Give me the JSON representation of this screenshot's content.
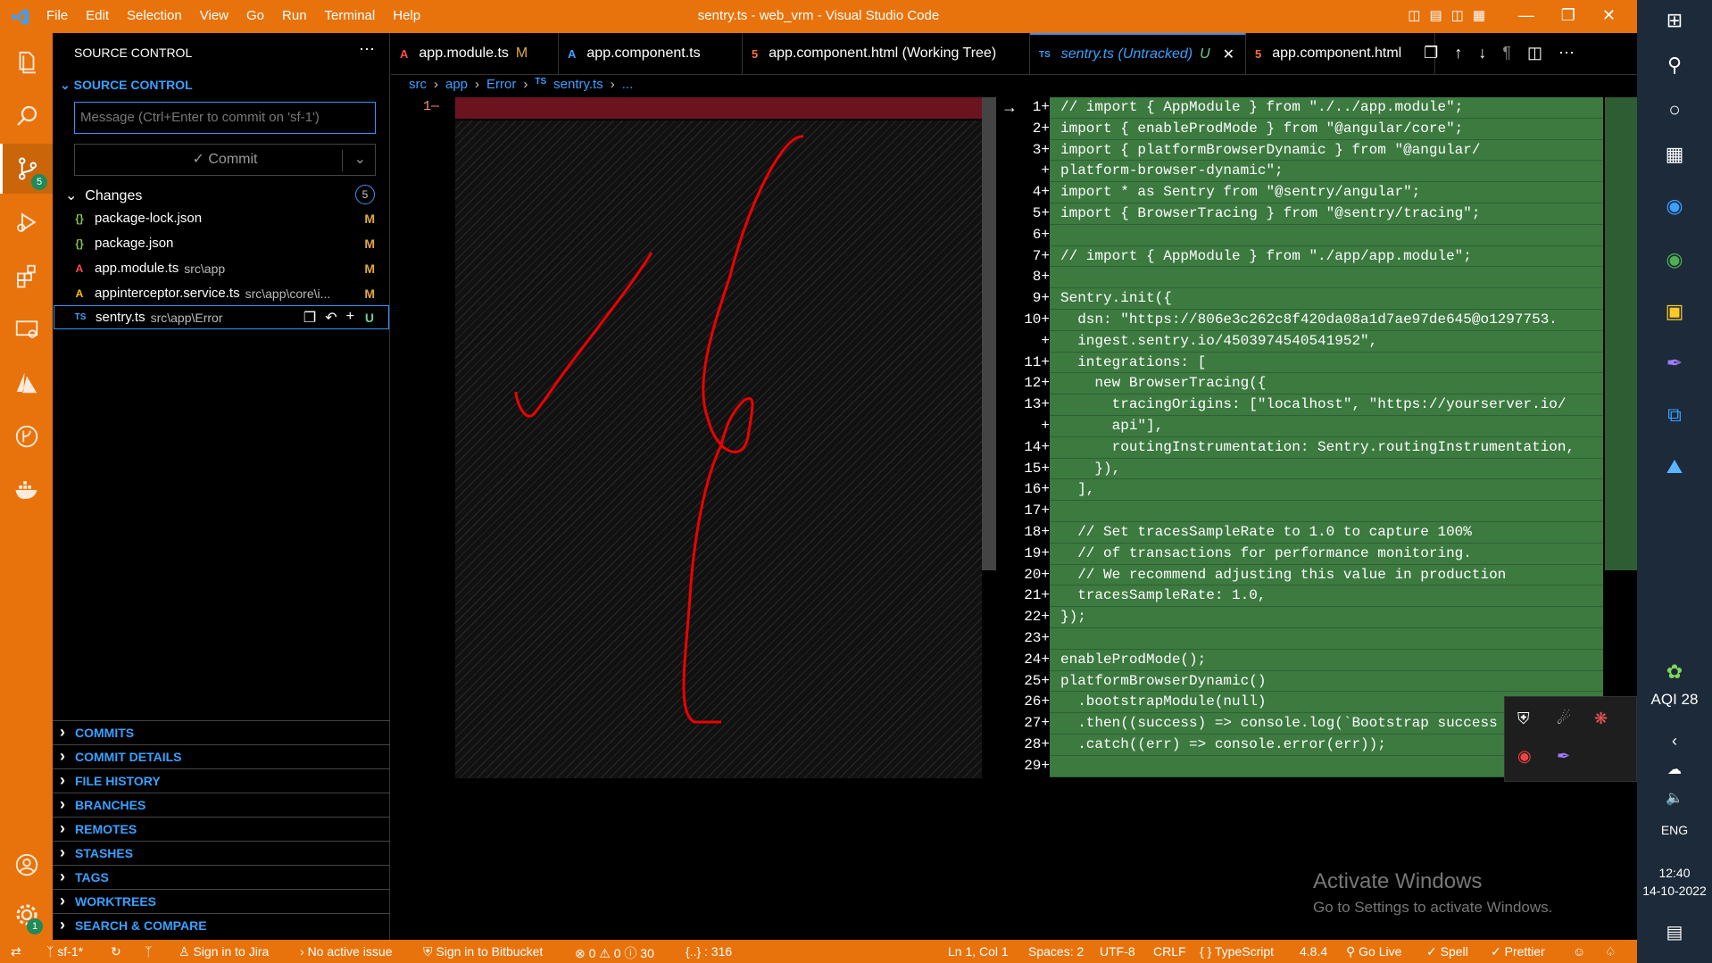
{
  "window": {
    "title": "sentry.ts - web_vrm - Visual Studio Code",
    "menu": [
      "File",
      "Edit",
      "Selection",
      "View",
      "Go",
      "Run",
      "Terminal",
      "Help"
    ]
  },
  "sidebar": {
    "title": "SOURCE CONTROL",
    "section": "SOURCE CONTROL",
    "message_placeholder": "Message (Ctrl+Enter to commit on 'sf-1')",
    "commit_label": "✓ Commit",
    "changes_label": "Changes",
    "changes_count": "5",
    "files": [
      {
        "name": "package-lock.json",
        "path": "",
        "status": "M",
        "icon": "{}"
      },
      {
        "name": "package.json",
        "path": "",
        "status": "M",
        "icon": "{}"
      },
      {
        "name": "app.module.ts",
        "path": "src\\app",
        "status": "M",
        "icon": "A"
      },
      {
        "name": "appinterceptor.service.ts",
        "path": "src\\app\\core\\i...",
        "status": "M",
        "icon": "A"
      },
      {
        "name": "sentry.ts",
        "path": "src\\app\\Error",
        "status": "U",
        "icon": "TS"
      }
    ],
    "panels": [
      "COMMITS",
      "COMMIT DETAILS",
      "FILE HISTORY",
      "BRANCHES",
      "REMOTES",
      "STASHES",
      "TAGS",
      "WORKTREES",
      "SEARCH & COMPARE"
    ]
  },
  "activity_badges": {
    "scm": "5",
    "settings": "1"
  },
  "tabs": [
    {
      "label": "app.module.ts",
      "mod": "M"
    },
    {
      "label": "app.component.ts",
      "mod": ""
    },
    {
      "label": "app.component.html (Working Tree)",
      "mod": ""
    },
    {
      "label": "sentry.ts (Untracked)",
      "mod": "U"
    },
    {
      "label": "app.component.html",
      "mod": ""
    }
  ],
  "breadcrumb": [
    "src",
    "app",
    "Error",
    "sentry.ts",
    "..."
  ],
  "left_line": "1",
  "code_lines": [
    {
      "n": "1+",
      "t": "// import { AppModule } from \"./../app.module\";"
    },
    {
      "n": "2+",
      "t": "import { enableProdMode } from \"@angular/core\";"
    },
    {
      "n": "3+",
      "t": "import { platformBrowserDynamic } from \"@angular/"
    },
    {
      "n": "+",
      "t": "platform-browser-dynamic\";"
    },
    {
      "n": "4+",
      "t": "import * as Sentry from \"@sentry/angular\";"
    },
    {
      "n": "5+",
      "t": "import { BrowserTracing } from \"@sentry/tracing\";"
    },
    {
      "n": "6+",
      "t": ""
    },
    {
      "n": "7+",
      "t": "// import { AppModule } from \"./app/app.module\";"
    },
    {
      "n": "8+",
      "t": ""
    },
    {
      "n": "9+",
      "t": "Sentry.init({"
    },
    {
      "n": "10+",
      "t": "  dsn: \"https://806e3c262c8f420da08a1d7ae97de645@o1297753."
    },
    {
      "n": "+",
      "t": "  ingest.sentry.io/4503974540541952\","
    },
    {
      "n": "11+",
      "t": "  integrations: ["
    },
    {
      "n": "12+",
      "t": "    new BrowserTracing({"
    },
    {
      "n": "13+",
      "t": "      tracingOrigins: [\"localhost\", \"https://yourserver.io/"
    },
    {
      "n": "+",
      "t": "      api\"],"
    },
    {
      "n": "14+",
      "t": "      routingInstrumentation: Sentry.routingInstrumentation,"
    },
    {
      "n": "15+",
      "t": "    }),"
    },
    {
      "n": "16+",
      "t": "  ],"
    },
    {
      "n": "17+",
      "t": ""
    },
    {
      "n": "18+",
      "t": "  // Set tracesSampleRate to 1.0 to capture 100%"
    },
    {
      "n": "19+",
      "t": "  // of transactions for performance monitoring."
    },
    {
      "n": "20+",
      "t": "  // We recommend adjusting this value in production"
    },
    {
      "n": "21+",
      "t": "  tracesSampleRate: 1.0,"
    },
    {
      "n": "22+",
      "t": "});"
    },
    {
      "n": "23+",
      "t": ""
    },
    {
      "n": "24+",
      "t": "enableProdMode();"
    },
    {
      "n": "25+",
      "t": "platformBrowserDynamic()"
    },
    {
      "n": "26+",
      "t": "  .bootstrapModule(null)"
    },
    {
      "n": "27+",
      "t": "  .then((success) => console.log(`Bootstrap success"
    },
    {
      "n": "28+",
      "t": "  .catch((err) => console.error(err));"
    },
    {
      "n": "29+",
      "t": ""
    }
  ],
  "activate": {
    "line1": "Activate Windows",
    "line2": "Go to Settings to activate Windows."
  },
  "status": {
    "branch": "sf-1*",
    "jira": "Sign in to Jira",
    "issue": "No active issue",
    "bitbucket": "Sign in to Bitbucket",
    "problems": "⊗ 0 ⚠ 0 ⓘ 30",
    "braces": "{..} : 316",
    "position": "Ln 1, Col 1",
    "spaces": "Spaces: 2",
    "encoding": "UTF-8",
    "eol": "CRLF",
    "language": "{ } TypeScript",
    "version": "4.8.4",
    "golive": "Go Live",
    "spell": "✓ Spell",
    "prettier": "✓ Prettier"
  },
  "taskbar": {
    "aqi": "AQI 28",
    "lang": "ENG",
    "time": "12:40",
    "date": "14-10-2022"
  },
  "colors": {
    "accent": "#e8730c",
    "added": "#3c7a40",
    "deleted": "#6b1420",
    "link": "#3aa0ff"
  }
}
